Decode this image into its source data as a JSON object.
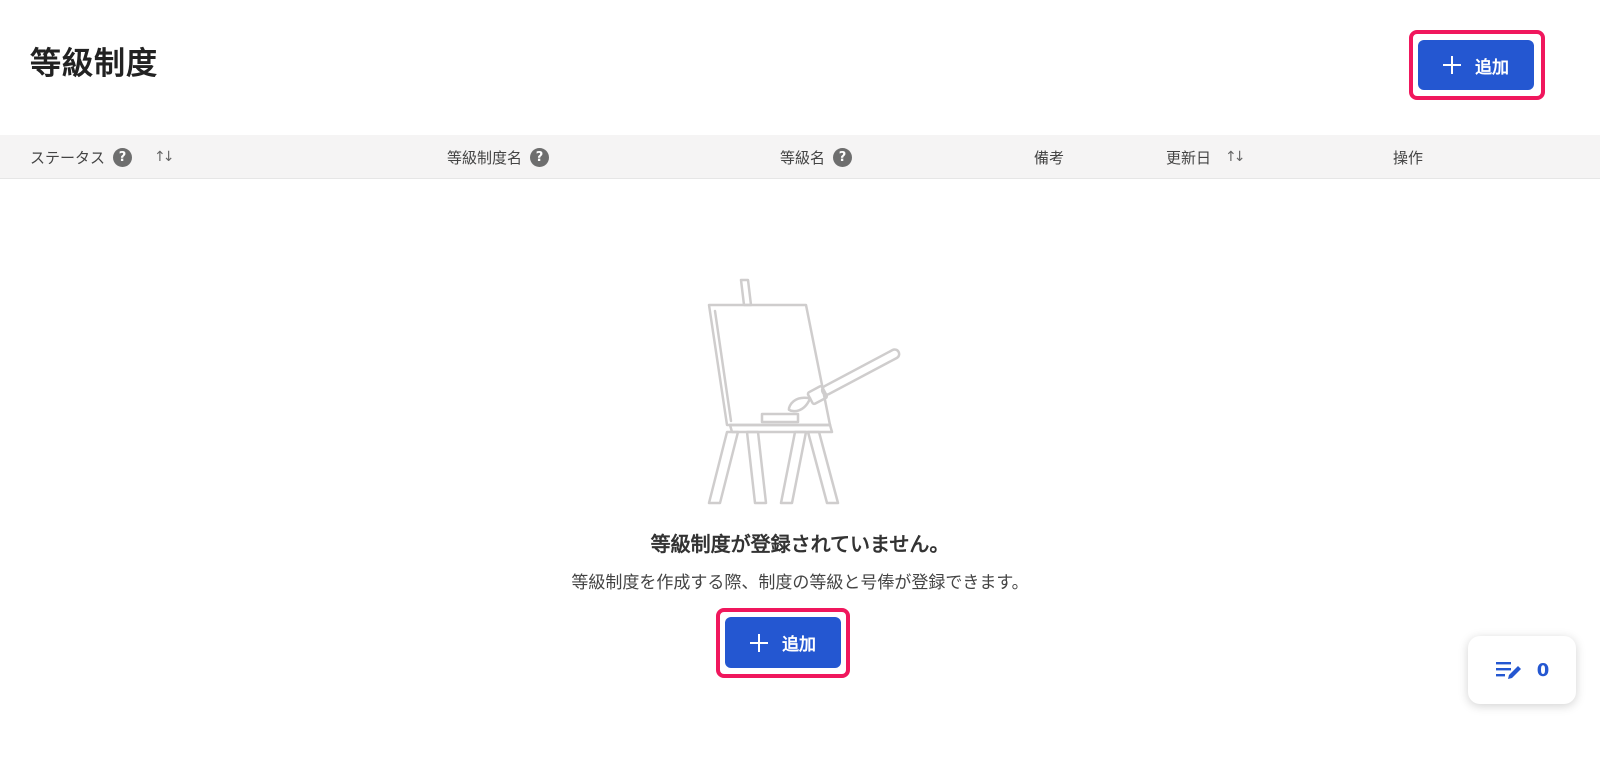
{
  "header": {
    "title": "等級制度",
    "add_label": "追加"
  },
  "table": {
    "columns": [
      {
        "label": "ステータス",
        "help": true,
        "sortable": true
      },
      {
        "label": "等級制度名",
        "help": true,
        "sortable": false
      },
      {
        "label": "等級名",
        "help": true,
        "sortable": false
      },
      {
        "label": "備考",
        "help": false,
        "sortable": false
      },
      {
        "label": "更新日",
        "help": false,
        "sortable": true
      },
      {
        "label": "操作",
        "help": false,
        "sortable": false
      }
    ],
    "help_glyph": "?",
    "sort_glyph": "↑↓"
  },
  "empty_state": {
    "illustration": "easel-icon",
    "title": "等級制度が登録されていません。",
    "description": "等級制度を作成する際、制度の等級と号俸が登録できます。",
    "add_label": "追加"
  },
  "fab": {
    "icon": "list-edit-icon",
    "count": "0"
  },
  "colors": {
    "primary": "#2457d1",
    "highlight": "#f0175d",
    "header_bg": "#f5f4f4"
  }
}
